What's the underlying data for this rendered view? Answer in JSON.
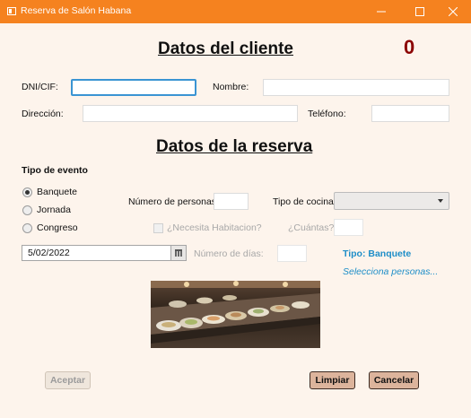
{
  "window": {
    "title": "Reserva de Salón Habana"
  },
  "cliente": {
    "heading": "Datos del cliente",
    "counter": "0",
    "dni_label": "DNI/CIF:",
    "dni_value": "",
    "nombre_label": "Nombre:",
    "nombre_value": "",
    "direccion_label": "Dirección:",
    "direccion_value": "",
    "telefono_label": "Teléfono:",
    "telefono_value": ""
  },
  "reserva": {
    "heading": "Datos de la reserva",
    "tipo_evento_label": "Tipo de evento",
    "evento_options": [
      {
        "label": "Banquete",
        "selected": true
      },
      {
        "label": "Jornada",
        "selected": false
      },
      {
        "label": "Congreso",
        "selected": false
      }
    ],
    "num_personas_label": "Número de personas:",
    "num_personas_value": "",
    "tipo_cocina_label": "Tipo de cocina:",
    "tipo_cocina_value": "",
    "habitacion_label": "¿Necesita Habitacion?",
    "habitacion_checked": false,
    "cuantas_label": "¿Cuántas?",
    "cuantas_value": "",
    "fecha_value": "5/02/2022",
    "num_dias_label": "Número de días:",
    "num_dias_value": "",
    "tipo_info": "Tipo: Banquete",
    "hint": "Selecciona personas..."
  },
  "buttons": {
    "aceptar": "Aceptar",
    "limpiar": "Limpiar",
    "cancelar": "Cancelar"
  },
  "icons": {
    "app": "window-app-icon",
    "minimize": "minimize-icon",
    "maximize": "maximize-icon",
    "close": "close-icon",
    "calendar": "calendar-icon",
    "dropdown": "chevron-down-icon"
  },
  "colors": {
    "titlebar": "#f5821f",
    "background": "#fdf4ec",
    "counter": "#8b0000",
    "info": "#1e8ec8",
    "button": "#dcb49c"
  }
}
